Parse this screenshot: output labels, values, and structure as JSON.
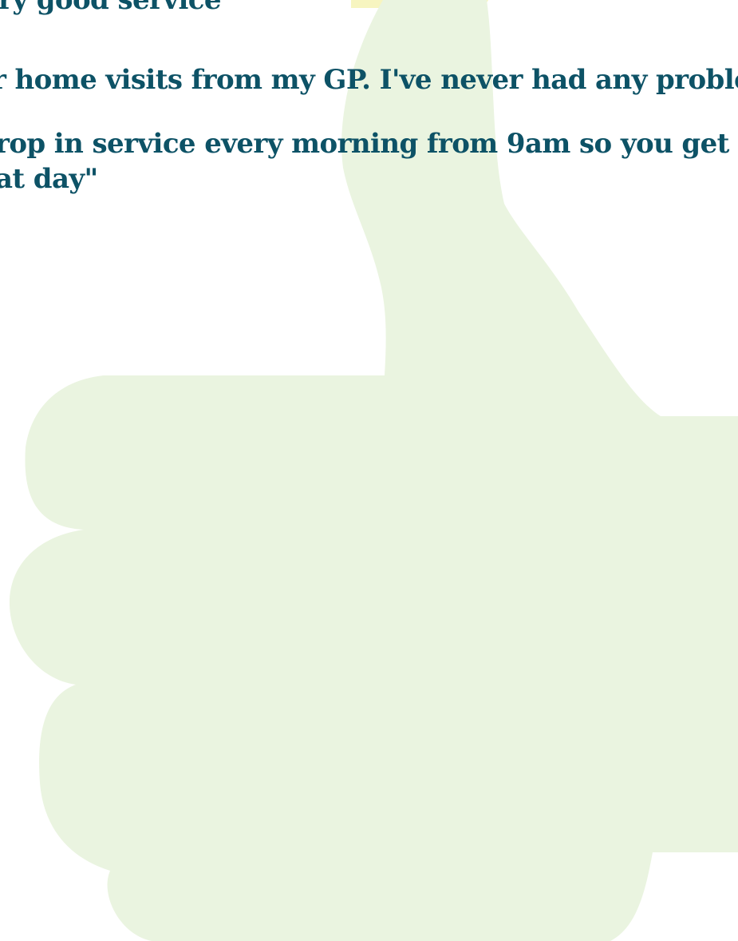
{
  "colors": {
    "background": "#ffffff",
    "thumb_fill": "#eaf4e0",
    "thumb_accent": "#f7f5c0",
    "quote_text": "#0d5266"
  },
  "icons": {
    "thumb": "thumbs-up-icon"
  },
  "quotes": [
    {
      "lines": [
        "ry good service\""
      ]
    },
    {
      "lines": [
        "r home visits from my GP. I've never had any problems\""
      ]
    },
    {
      "lines": [
        "rop in service every morning from 9am so you get",
        "at day\""
      ]
    }
  ]
}
